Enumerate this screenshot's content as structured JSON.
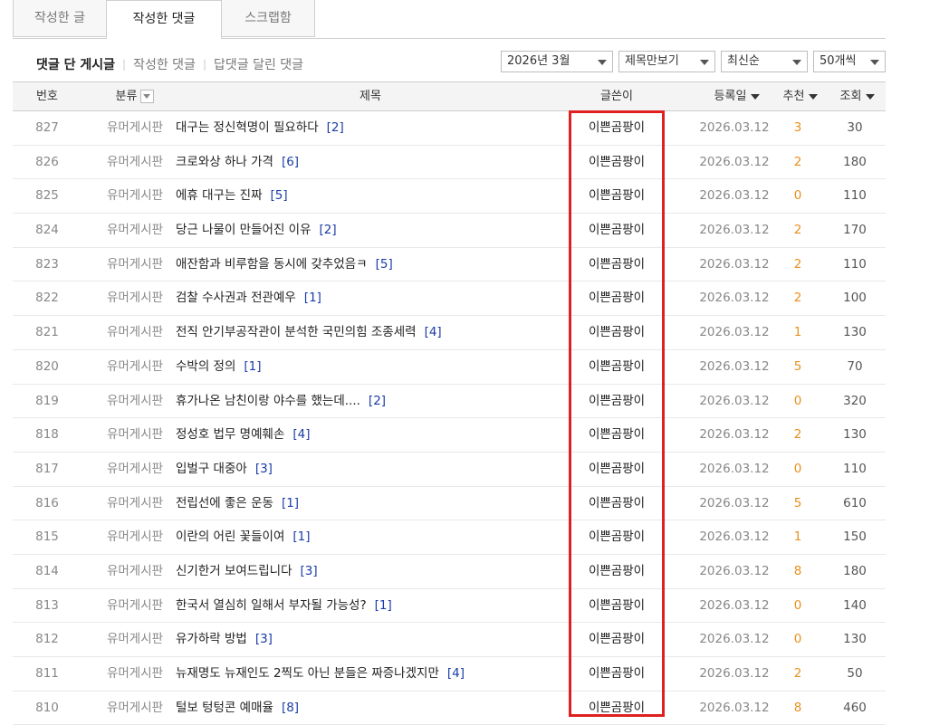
{
  "tabs": [
    "작성한 글",
    "작성한 댓글",
    "스크랩함"
  ],
  "subnav": {
    "items": [
      "댓글 단 게시글",
      "작성한 댓글",
      "답댓글 달린 댓글"
    ]
  },
  "controls": {
    "month": "2026년 3월",
    "view": "제목만보기",
    "sort": "최신순",
    "count": "50개씩"
  },
  "headers": {
    "num": "번호",
    "category": "분류",
    "title": "제목",
    "author": "글쓴이",
    "date": "등록일",
    "recommend": "추천",
    "views": "조회"
  },
  "colors": {
    "highlight": "#e02020",
    "comment_count": "#1a3ca8",
    "recommend": "#e8901e"
  },
  "rows": [
    {
      "num": "827",
      "category": "유머게시판",
      "title": "대구는 정신혁명이 필요하다",
      "comments": "[2]",
      "author": "이쁜곰팡이",
      "date": "2026.03.12",
      "recommend": "3",
      "views": "30"
    },
    {
      "num": "826",
      "category": "유머게시판",
      "title": "크로와상 하나 가격",
      "comments": "[6]",
      "author": "이쁜곰팡이",
      "date": "2026.03.12",
      "recommend": "2",
      "views": "180"
    },
    {
      "num": "825",
      "category": "유머게시판",
      "title": "에휴 대구는 진짜",
      "comments": "[5]",
      "author": "이쁜곰팡이",
      "date": "2026.03.12",
      "recommend": "0",
      "views": "110"
    },
    {
      "num": "824",
      "category": "유머게시판",
      "title": "당근 나물이 만들어진 이유",
      "comments": "[2]",
      "author": "이쁜곰팡이",
      "date": "2026.03.12",
      "recommend": "2",
      "views": "170"
    },
    {
      "num": "823",
      "category": "유머게시판",
      "title": "애잔함과 비루함을 동시에 갖추었음ㅋ",
      "comments": "[5]",
      "author": "이쁜곰팡이",
      "date": "2026.03.12",
      "recommend": "2",
      "views": "110"
    },
    {
      "num": "822",
      "category": "유머게시판",
      "title": "검찰 수사권과 전관예우",
      "comments": "[1]",
      "author": "이쁜곰팡이",
      "date": "2026.03.12",
      "recommend": "2",
      "views": "100"
    },
    {
      "num": "821",
      "category": "유머게시판",
      "title": "전직 안기부공작관이 분석한 국민의힘 조종세력",
      "comments": "[4]",
      "author": "이쁜곰팡이",
      "date": "2026.03.12",
      "recommend": "1",
      "views": "130"
    },
    {
      "num": "820",
      "category": "유머게시판",
      "title": "수박의 정의",
      "comments": "[1]",
      "author": "이쁜곰팡이",
      "date": "2026.03.12",
      "recommend": "5",
      "views": "70"
    },
    {
      "num": "819",
      "category": "유머게시판",
      "title": "휴가나온 남친이랑 야수를 했는데....",
      "comments": "[2]",
      "author": "이쁜곰팡이",
      "date": "2026.03.12",
      "recommend": "0",
      "views": "320"
    },
    {
      "num": "818",
      "category": "유머게시판",
      "title": "정성호 법무 명예훼손",
      "comments": "[4]",
      "author": "이쁜곰팡이",
      "date": "2026.03.12",
      "recommend": "2",
      "views": "130"
    },
    {
      "num": "817",
      "category": "유머게시판",
      "title": "입벌구 대중아",
      "comments": "[3]",
      "author": "이쁜곰팡이",
      "date": "2026.03.12",
      "recommend": "0",
      "views": "110"
    },
    {
      "num": "816",
      "category": "유머게시판",
      "title": "전립선에 좋은 운동",
      "comments": "[1]",
      "author": "이쁜곰팡이",
      "date": "2026.03.12",
      "recommend": "5",
      "views": "610"
    },
    {
      "num": "815",
      "category": "유머게시판",
      "title": "이란의 어린 꽃들이여",
      "comments": "[1]",
      "author": "이쁜곰팡이",
      "date": "2026.03.12",
      "recommend": "1",
      "views": "150"
    },
    {
      "num": "814",
      "category": "유머게시판",
      "title": "신기한거 보여드립니다",
      "comments": "[3]",
      "author": "이쁜곰팡이",
      "date": "2026.03.12",
      "recommend": "8",
      "views": "180"
    },
    {
      "num": "813",
      "category": "유머게시판",
      "title": "한국서 열심히 일해서 부자될 가능성?",
      "comments": "[1]",
      "author": "이쁜곰팡이",
      "date": "2026.03.12",
      "recommend": "0",
      "views": "140"
    },
    {
      "num": "812",
      "category": "유머게시판",
      "title": "유가하락 방법",
      "comments": "[3]",
      "author": "이쁜곰팡이",
      "date": "2026.03.12",
      "recommend": "0",
      "views": "130"
    },
    {
      "num": "811",
      "category": "유머게시판",
      "title": "뉴재명도 뉴재인도 2찍도 아닌 분들은 짜증나겠지만",
      "comments": "[4]",
      "author": "이쁜곰팡이",
      "date": "2026.03.12",
      "recommend": "2",
      "views": "50"
    },
    {
      "num": "810",
      "category": "유머게시판",
      "title": "털보 텅텅콘 예매율",
      "comments": "[8]",
      "author": "이쁜곰팡이",
      "date": "2026.03.12",
      "recommend": "8",
      "views": "460"
    }
  ]
}
